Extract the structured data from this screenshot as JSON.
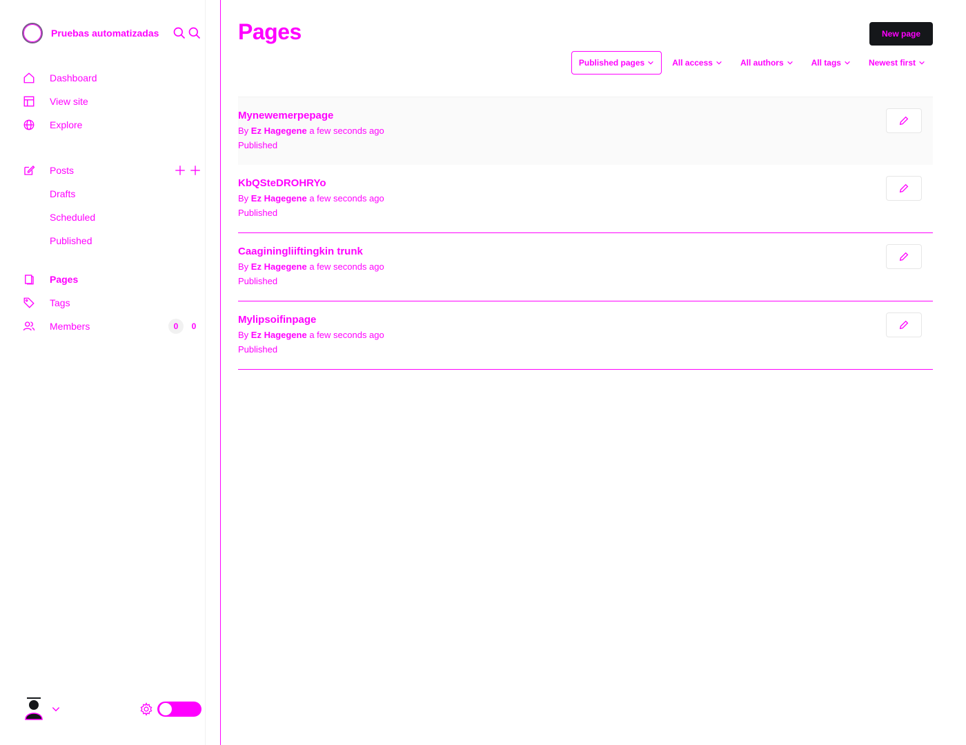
{
  "colors": {
    "accent": "#ff00ff",
    "dark": "#15171a"
  },
  "brand": {
    "name": "Pruebas automatizadas",
    "icon": "site-logo",
    "search_icon": "search-icon"
  },
  "nav": {
    "dashboard": "Dashboard",
    "view_site": "View site",
    "explore": "Explore",
    "posts": "Posts",
    "drafts": "Drafts",
    "scheduled": "Scheduled",
    "published": "Published",
    "pages": "Pages",
    "tags": "Tags",
    "members": "Members",
    "members_count": "0",
    "members_count_alt": "0"
  },
  "header": {
    "title": "Pages",
    "new_button": "New page"
  },
  "filters": {
    "type": "Published pages",
    "access": "All access",
    "authors": "All authors",
    "tags": "All tags",
    "order": "Newest first"
  },
  "pages": [
    {
      "title": "Mynewemerpepage",
      "meta_prefix": "By",
      "author": "Ez Hagegene",
      "time": "a few seconds ago",
      "status": "Published"
    },
    {
      "title": "KbQSteDROHRYo",
      "meta_prefix": "By",
      "author": "Ez Hagegene",
      "time": "a few seconds ago",
      "status": "Published"
    },
    {
      "title": "Caaginingliiftingkin trunk",
      "meta_prefix": "By",
      "author": "Ez Hagegene",
      "time": "a few seconds ago",
      "status": "Published"
    },
    {
      "title": "Mylipsoifinpage",
      "meta_prefix": "By",
      "author": "Ez Hagegene",
      "time": "a few seconds ago",
      "status": "Published"
    }
  ]
}
